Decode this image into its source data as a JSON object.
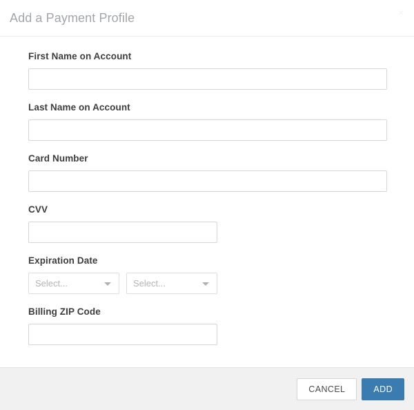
{
  "dialog": {
    "title": "Add a Payment Profile",
    "close_icon": "close-icon",
    "close_label": "×"
  },
  "form": {
    "fields": [
      {
        "label": "First Name on Account",
        "name": "first-name-on-account",
        "type": "text",
        "value": "",
        "placeholder": "",
        "width": "wide"
      },
      {
        "label": "Last Name on Account",
        "name": "last-name-on-account",
        "type": "text",
        "value": "",
        "placeholder": "",
        "width": "wide"
      },
      {
        "label": "Card Number",
        "name": "card-number",
        "type": "text",
        "value": "",
        "placeholder": "",
        "width": "wide"
      },
      {
        "label": "CVV",
        "name": "cvv",
        "type": "text",
        "value": "",
        "placeholder": "",
        "width": "narrow"
      },
      {
        "label": "Expiration Date",
        "name": "expiration-date",
        "type": "selects",
        "selects": [
          {
            "name": "expiration-month-select",
            "value": "Select...",
            "caret": "chevron-down-icon"
          },
          {
            "name": "expiration-year-select",
            "value": "Select...",
            "caret": "chevron-down-icon"
          }
        ]
      },
      {
        "label": "Billing ZIP Code",
        "name": "billing-zip-code",
        "type": "text",
        "value": "",
        "placeholder": "",
        "width": "narrow"
      }
    ]
  },
  "footer": {
    "cancel_label": "CANCEL",
    "add_label": "ADD"
  },
  "colors": {
    "accent": "#3b7cb0",
    "label_text": "#3d3d3f",
    "title_text": "#a3a6ab",
    "placeholder_text": "#b4b4b6",
    "input_border": "#d6d6d8",
    "footer_background": "#f1f1f1"
  }
}
